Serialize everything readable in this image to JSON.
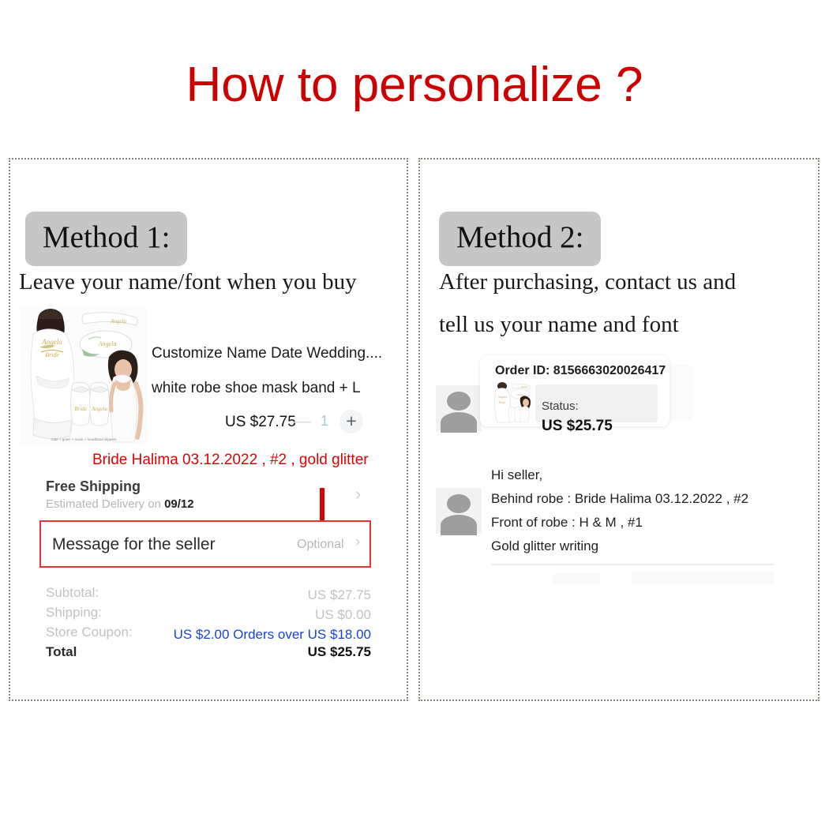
{
  "header": {
    "title": "How to personalize ?",
    "title_color": "#cc0000"
  },
  "panels": {
    "method1": {
      "badge": "Method 1:",
      "subtitle": "Leave your name/font when you buy",
      "listing": {
        "title": "Customize Name Date Wedding....",
        "variant": "white robe shoe mask band + L",
        "price": "US $27.75",
        "qty_minus": "—",
        "qty_value": "1",
        "qty_plus": "+"
      },
      "red_note": "Bride Halima 03.12.2022 , #2 ,  gold glitter",
      "shipping": {
        "title": "Free Shipping",
        "estimate_label": "Estimated Delivery on",
        "estimate_date": "09/12",
        "chevron": "›"
      },
      "message_box": {
        "label": "Message for the seller",
        "optional": "Optional",
        "chevron": "›",
        "border_color": "#e53232"
      },
      "totals": [
        {
          "label": "Subtotal:",
          "value": "US $27.75",
          "style": "muted"
        },
        {
          "label": "Shipping:",
          "value": "US $0.00",
          "style": "muted"
        },
        {
          "label": "Store Coupon:",
          "value": "US $2.00 Orders over US $18.00",
          "style": "blue"
        },
        {
          "label": "Total",
          "value": "US $25.75",
          "style": "strong"
        }
      ]
    },
    "method2": {
      "badge": "Method 2:",
      "subtitle_line1": "After purchasing, contact us and",
      "subtitle_line2": "tell us your name and font",
      "order_card": {
        "order_id": "Order ID: 8156663020026417",
        "status_label": "Status:",
        "price": "US $25.75"
      },
      "chat_lines": [
        "Hi seller,",
        "Behind robe : Bride Halima 03.12.2022 , #2",
        "Front of  robe : H & M , #1",
        "Gold glitter writing"
      ]
    }
  }
}
